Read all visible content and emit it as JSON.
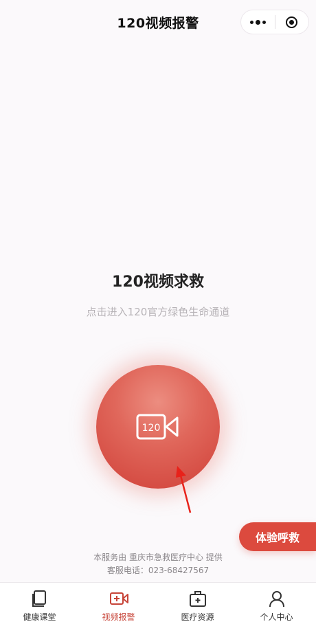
{
  "header": {
    "title": "120视频报警"
  },
  "main": {
    "title": "120视频求救",
    "subtitle": "点击进入120官方绿色生命通道",
    "camera_text": "120"
  },
  "try_button": {
    "label": "体验呼救"
  },
  "footer": {
    "line1": "本服务由 重庆市急救医疗中心 提供",
    "line2": "客服电话：023-68427567"
  },
  "tabs": [
    {
      "label": "健康课堂",
      "icon": "book-icon",
      "active": false
    },
    {
      "label": "视频报警",
      "icon": "video-camera-icon",
      "active": true
    },
    {
      "label": "医疗资源",
      "icon": "medical-kit-icon",
      "active": false
    },
    {
      "label": "个人中心",
      "icon": "person-icon",
      "active": false
    }
  ],
  "colors": {
    "accent": "#dc4a3e",
    "active_tab": "#c74438"
  }
}
